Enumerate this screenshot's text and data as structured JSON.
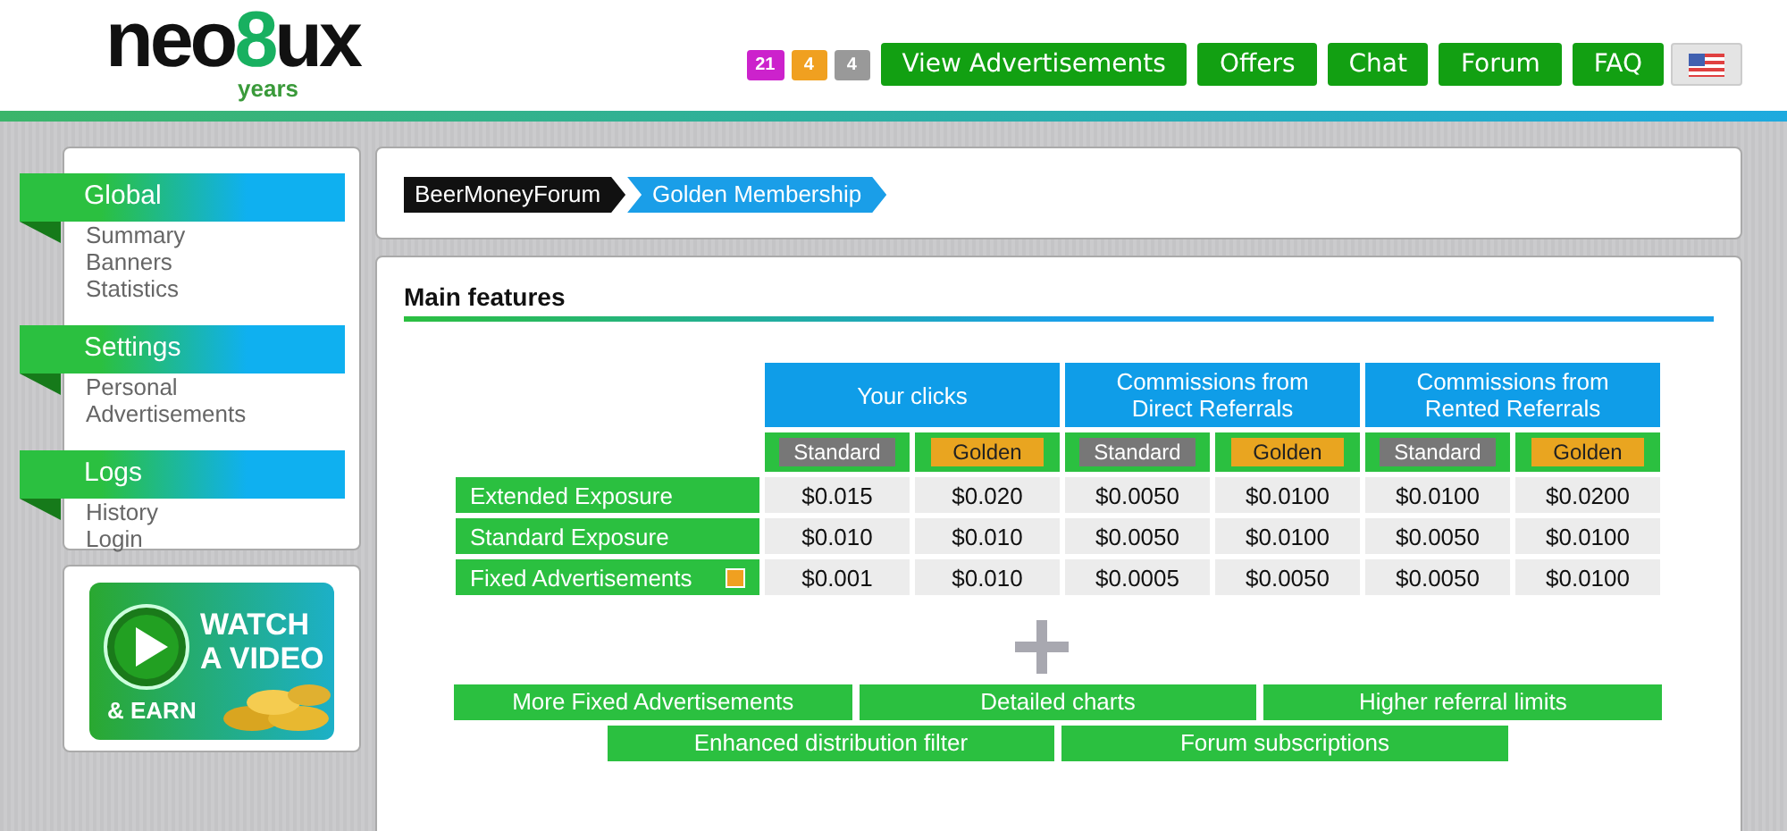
{
  "logo": {
    "prefix": "neo",
    "digit": "8",
    "suffix": "ux",
    "tagline": "years"
  },
  "counters": [
    {
      "value": "21",
      "color": "#cc22cc"
    },
    {
      "value": "4",
      "color": "#f0a020"
    },
    {
      "value": "4",
      "color": "#999999"
    }
  ],
  "nav": [
    "View Advertisements",
    "Offers",
    "Chat",
    "Forum",
    "FAQ"
  ],
  "sidebar": [
    {
      "title": "Global",
      "items": [
        "Summary",
        "Banners",
        "Statistics"
      ]
    },
    {
      "title": "Settings",
      "items": [
        "Personal",
        "Advertisements"
      ]
    },
    {
      "title": "Logs",
      "items": [
        "History",
        "Login"
      ]
    }
  ],
  "promo": {
    "lines": [
      "WATCH",
      "A VIDEO"
    ],
    "tag": "& EARN"
  },
  "breadcrumb": [
    "BeerMoneyForum",
    "Golden Membership"
  ],
  "section_title": "Main features",
  "table": {
    "groups": [
      [
        "Your clicks"
      ],
      [
        "Commissions from",
        "Direct Referrals"
      ],
      [
        "Commissions from",
        "Rented Referrals"
      ]
    ],
    "subheaders": [
      {
        "label": "Standard",
        "kind": "standard"
      },
      {
        "label": "Golden",
        "kind": "golden"
      },
      {
        "label": "Standard",
        "kind": "standard"
      },
      {
        "label": "Golden",
        "kind": "golden"
      },
      {
        "label": "Standard",
        "kind": "standard"
      },
      {
        "label": "Golden",
        "kind": "golden"
      }
    ],
    "rows": [
      {
        "label": "Extended Exposure",
        "marked": false,
        "values": [
          "$0.015",
          "$0.020",
          "$0.0050",
          "$0.0100",
          "$0.0100",
          "$0.0200"
        ]
      },
      {
        "label": "Standard Exposure",
        "marked": false,
        "values": [
          "$0.010",
          "$0.010",
          "$0.0050",
          "$0.0100",
          "$0.0050",
          "$0.0100"
        ]
      },
      {
        "label": "Fixed Advertisements",
        "marked": true,
        "values": [
          "$0.001",
          "$0.010",
          "$0.0005",
          "$0.0050",
          "$0.0050",
          "$0.0100"
        ]
      }
    ]
  },
  "extras": [
    [
      "More Fixed Advertisements",
      "Detailed charts",
      "Higher referral limits"
    ],
    [
      "Enhanced distribution filter",
      "Forum subscriptions"
    ]
  ]
}
